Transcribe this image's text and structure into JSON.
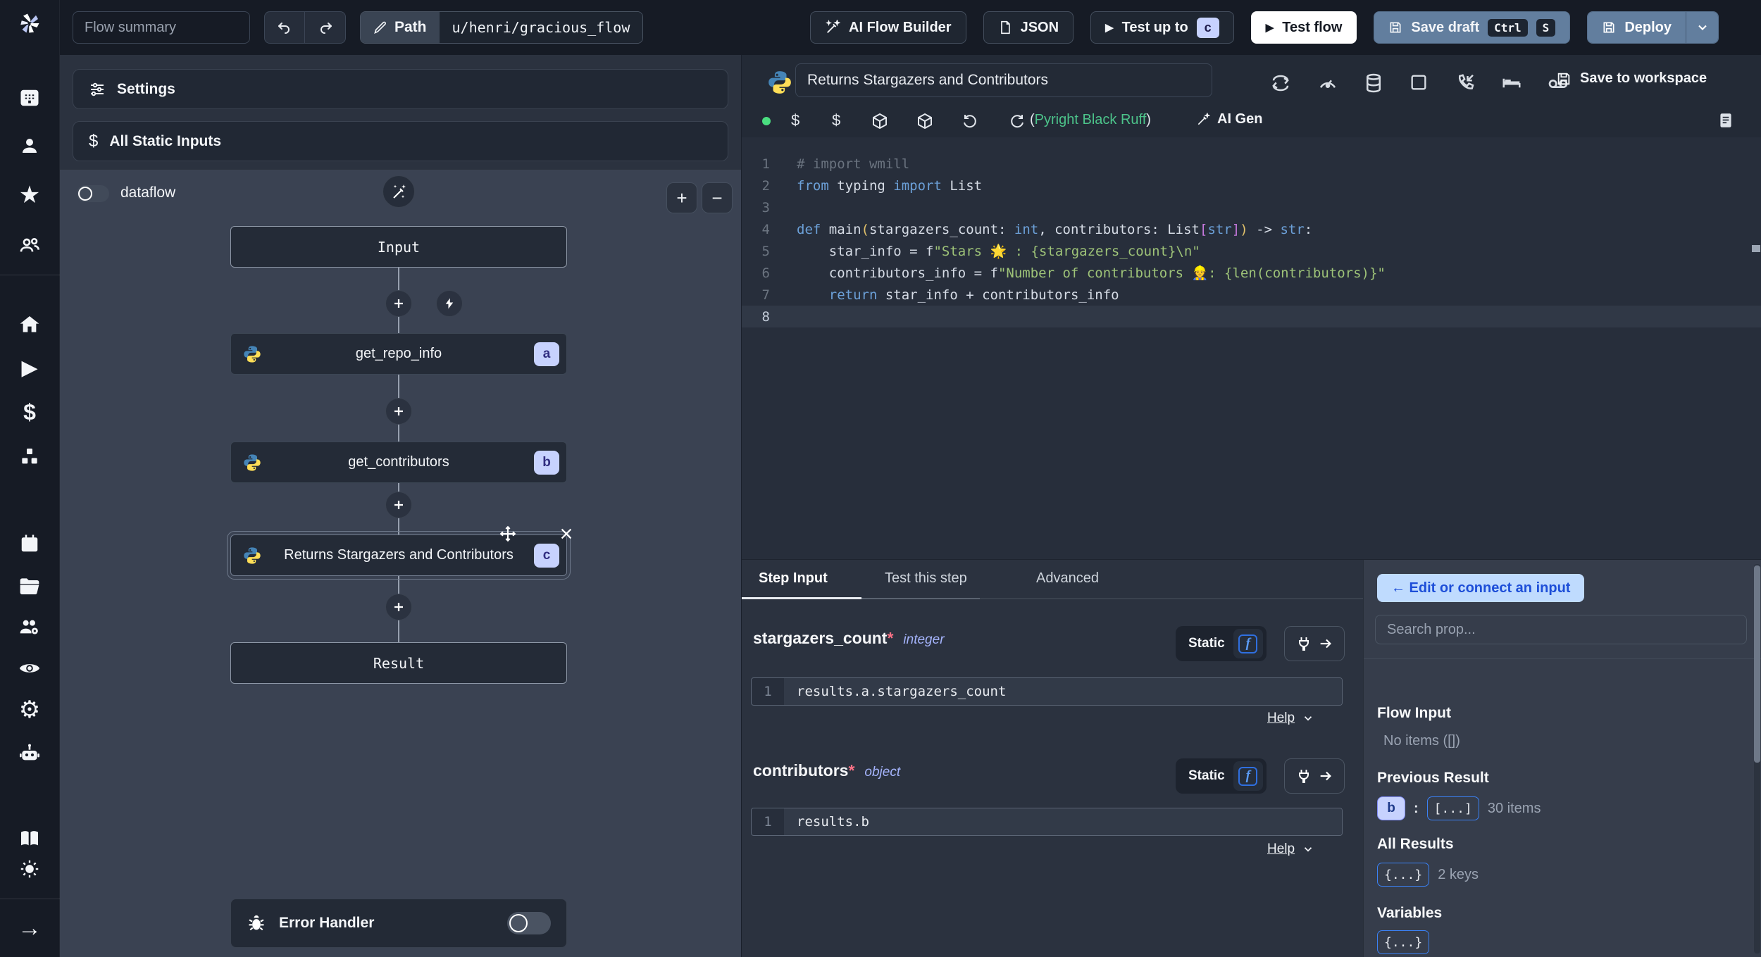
{
  "topbar": {
    "flow_summary_placeholder": "Flow summary",
    "path_label": "Path",
    "path_value": "u/henri/gracious_flow",
    "ai_flow_builder": "AI Flow Builder",
    "json_label": "JSON",
    "test_up_to": "Test up to",
    "test_up_to_key": "c",
    "test_flow": "Test flow",
    "save_draft": "Save draft",
    "save_draft_keys": [
      "Ctrl",
      "S"
    ],
    "deploy": "Deploy"
  },
  "flow_panel": {
    "settings": "Settings",
    "all_static_inputs": "All Static Inputs",
    "dataflow_label": "dataflow",
    "zoom_in": "+",
    "zoom_out": "−",
    "nodes": {
      "input": "Input",
      "step_a": {
        "label": "get_repo_info",
        "badge": "a"
      },
      "step_b": {
        "label": "get_contributors",
        "badge": "b"
      },
      "step_c": {
        "label": "Returns Stargazers and Contributors",
        "badge": "c"
      },
      "result": "Result"
    },
    "error_handler": "Error Handler"
  },
  "step_header": {
    "title_value": "Returns Stargazers and Contributors",
    "save_to_workspace": "Save to workspace"
  },
  "editor": {
    "assistants_open": "(",
    "assistants": "Pyright Black Ruff",
    "assistants_close": ")",
    "ai_gen": "AI Gen",
    "active_line": 8,
    "lines": [
      [
        [
          "c",
          "# import wmill"
        ]
      ],
      [
        [
          "k",
          "from"
        ],
        [
          "t",
          " typing "
        ],
        [
          "k",
          "import"
        ],
        [
          "t",
          " List"
        ]
      ],
      [],
      [
        [
          "k",
          "def"
        ],
        [
          "t",
          " main"
        ],
        [
          "p1",
          "("
        ],
        [
          "t",
          "stargazers_count: "
        ],
        [
          "k",
          "int"
        ],
        [
          "t",
          ", contributors: List"
        ],
        [
          "p2",
          "["
        ],
        [
          "k",
          "str"
        ],
        [
          "p2",
          "]"
        ],
        [
          "p1",
          ")"
        ],
        [
          "t",
          " -> "
        ],
        [
          "k",
          "str"
        ],
        [
          "t",
          ":"
        ]
      ],
      [
        [
          "t",
          "    star_info = f"
        ],
        [
          "s",
          "\"Stars 🌟 : {stargazers_count}\\n\""
        ]
      ],
      [
        [
          "t",
          "    contributors_info = f"
        ],
        [
          "s",
          "\"Number of contributors 👷: {len(contributors)}\""
        ]
      ],
      [
        [
          "t",
          "    "
        ],
        [
          "k",
          "return"
        ],
        [
          "t",
          " star_info + contributors_info"
        ]
      ],
      []
    ]
  },
  "step_detail": {
    "tabs": [
      "Step Input",
      "Test this step",
      "Advanced"
    ],
    "active_tab": "Step Input",
    "fields": [
      {
        "name": "stargazers_count",
        "required": "*",
        "type": "integer",
        "mode": "Static",
        "expr_line": "1",
        "expr": "results.a.stargazers_count",
        "help": "Help"
      },
      {
        "name": "contributors",
        "required": "*",
        "type": "object",
        "mode": "Static",
        "expr_line": "1",
        "expr": "results.b",
        "help": "Help"
      }
    ]
  },
  "prop_picker": {
    "edit_connect": "← Edit or connect an input",
    "search_placeholder": "Search prop...",
    "flow_input_title": "Flow Input",
    "flow_input_empty": "No items ([])",
    "previous_result_title": "Previous Result",
    "previous_result_badge": "b",
    "colon": ":",
    "array_badge": "[...]",
    "previous_result_count": "30 items",
    "all_results_title": "All Results",
    "object_badge": "{...}",
    "all_results_count": "2 keys",
    "variables_title": "Variables",
    "variables_badge": "{...}"
  },
  "colors": {
    "accent_lavender": "#c7d2fe",
    "accent_blue": "#3b82f6",
    "slate_button": "#627e9e",
    "success_green": "#4cc38a",
    "light_blue_button": "#bfdbfe"
  }
}
